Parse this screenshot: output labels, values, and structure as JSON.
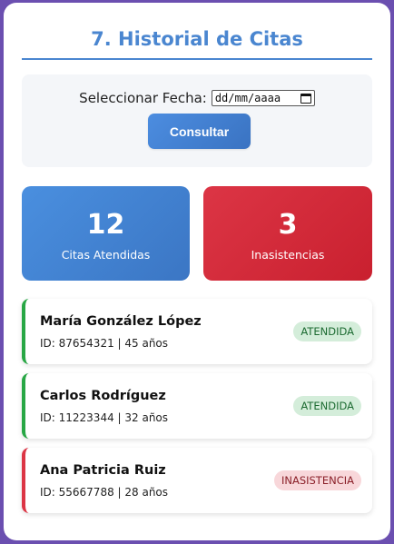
{
  "page": {
    "title": "7. Historial de Citas"
  },
  "date_filter": {
    "label": "Seleccionar Fecha:",
    "input_placeholder": "dd/mm/aaaa",
    "button_label": "Consultar"
  },
  "stats": {
    "attended": {
      "value": "12",
      "label": "Citas Atendidas"
    },
    "no_shows": {
      "value": "3",
      "label": "Inasistencias"
    }
  },
  "appointments": [
    {
      "name": "María González López",
      "details": "ID: 87654321 | 45 años",
      "status": "ATENDIDA"
    },
    {
      "name": "Carlos Rodríguez",
      "details": "ID: 11223344 | 32 años",
      "status": "ATENDIDA"
    },
    {
      "name": "Ana Patricia Ruiz",
      "details": "ID: 55667788 | 28 años",
      "status": "INASISTENCIA"
    }
  ],
  "colors": {
    "accent": "#4a86d0",
    "attended": "#28a745",
    "no_show": "#dc3545",
    "background": "#6b4fb0"
  }
}
